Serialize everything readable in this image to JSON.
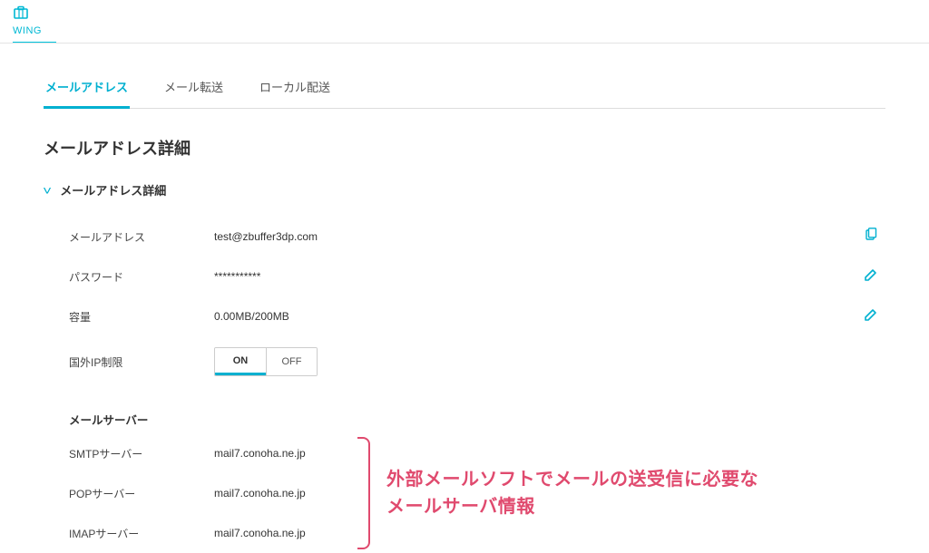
{
  "brand": {
    "name": "WING"
  },
  "tabs": [
    {
      "label": "メールアドレス",
      "active": true
    },
    {
      "label": "メール転送",
      "active": false
    },
    {
      "label": "ローカル配送",
      "active": false
    }
  ],
  "page_title": "メールアドレス詳細",
  "section": {
    "title": "メールアドレス詳細",
    "rows": {
      "email_label": "メールアドレス",
      "email_value": "test@zbuffer3dp.com",
      "password_label": "パスワード",
      "password_value": "***********",
      "quota_label": "容量",
      "quota_value": "0.00MB/200MB",
      "iprestrict_label": "国外IP制限",
      "toggle_on": "ON",
      "toggle_off": "OFF"
    }
  },
  "mailserver": {
    "title": "メールサーバー",
    "smtp_label": "SMTPサーバー",
    "smtp_value": "mail7.conoha.ne.jp",
    "pop_label": "POPサーバー",
    "pop_value": "mail7.conoha.ne.jp",
    "imap_label": "IMAPサーバー",
    "imap_value": "mail7.conoha.ne.jp"
  },
  "annotation": {
    "line1": "外部メールソフトでメールの送受信に必要な",
    "line2": "メールサーバ情報"
  }
}
